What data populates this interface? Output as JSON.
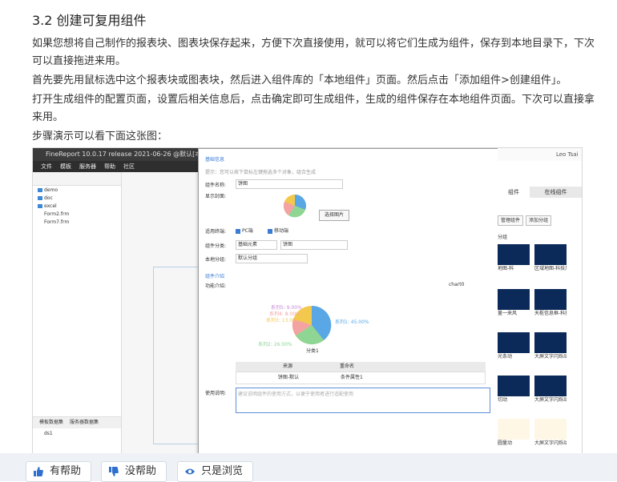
{
  "heading": "3.2 创建可复用组件",
  "paragraphs": [
    "如果您想将自己制作的报表块、图表块保存起来，方便下次直接使用，就可以将它们生成为组件，保存到本地目录下，下次可以直接拖进来用。",
    "首先要先用鼠标选中这个报表块或图表块，然后进入组件库的「本地组件」页面。然后点击「添加组件>创建组件」。",
    "打开生成组件的配置页面，设置后相关信息后，点击确定即可生成组件，生成的组件保存在本地组件页面。下次可以直接拿来用。",
    "步骤演示可以看下面这张图："
  ],
  "screenshot": {
    "app_title": "FineReport 10.0.17 release 2021-06-26 @默认[本地目录]",
    "menu": [
      "文件",
      "模板",
      "服务器",
      "帮助",
      "社区"
    ],
    "tree": [
      "demo",
      "doc",
      "excel",
      "Form2.frm",
      "Form7.frm"
    ],
    "tree_folders": [
      true,
      true,
      true,
      false,
      false
    ],
    "left_tabs": [
      "模板数据集",
      "服务器数据集"
    ],
    "left_foot": "ds1",
    "dialog": {
      "section_basic": "基础信息",
      "tip": "提示：您可以按下鼠标左键拖选多个对象，组合生成",
      "name_label": "组件名称:",
      "name_value": "饼图",
      "cover_label": "显示封面:",
      "select_image": "选择图片",
      "terminal_label": "适用终端:",
      "terminal_pc": "PC端",
      "terminal_mobile": "移动端",
      "category_label": "组件分类:",
      "category_value1": "基础元素",
      "category_value2": "饼图",
      "local_group_label": "本地分组:",
      "local_group_value": "默认分组",
      "section_intro": "组件介绍",
      "preview_label": "功能介绍:",
      "chart_name": "chart0",
      "pie_labels": [
        "系列1: 45.00%",
        "系列2: 26.00%",
        "系列3: 13.00%",
        "系列4: 8.00%",
        "系列5: 9.00%"
      ],
      "pie_title": "分类1",
      "table_headers": [
        "来源",
        "重命名"
      ],
      "table_row": [
        "饼图-默认",
        "条件属性1"
      ],
      "usage_label": "使用说明:",
      "usage_placeholder": "建议说明组件的使用方式，以便于使用者进行适配使用"
    },
    "right_panel": {
      "user": "Leo Tsai",
      "tabs": [
        "组件",
        "在线组件"
      ],
      "buttons": [
        "管理组件",
        "添加分组"
      ],
      "section": "分组",
      "tiles": [
        "地图-科",
        "区域地图-科技风",
        "量一来风",
        "天枢信息框-科技风",
        "光条动",
        "大屏文字闪烁动",
        "切动",
        "大屏文字闪烁动",
        "圆量动",
        "大屏文字闪烁动"
      ]
    }
  },
  "feedback": {
    "helpful": "有帮助",
    "not_helpful": "没帮助",
    "just_browsing": "只是浏览"
  },
  "colors": {
    "accent": "#3a7bd5",
    "feedback_bar": "#eef1f6"
  }
}
